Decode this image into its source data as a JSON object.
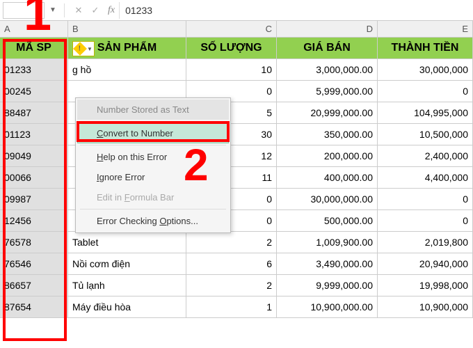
{
  "formula_bar": {
    "name_box": "",
    "fx": "fx",
    "value": "01233"
  },
  "col_headers": [
    "A",
    "B",
    "C",
    "D",
    "E"
  ],
  "table_headers": {
    "a": "MÃ SP",
    "b": "SẢN PHẨM",
    "c": "SỐ LƯỢNG",
    "d": "GIÁ BÁN",
    "e": "THÀNH TIỀN"
  },
  "rows": [
    {
      "a": "01233",
      "b": "g hồ",
      "c": "10",
      "d": "3,000,000.00",
      "e": "30,000,000"
    },
    {
      "a": "00245",
      "b": "",
      "c": "0",
      "d": "5,999,000.00",
      "e": "0"
    },
    {
      "a": "88487",
      "b": "",
      "c": "5",
      "d": "20,999,000.00",
      "e": "104,995,000"
    },
    {
      "a": "01123",
      "b": "",
      "c": "30",
      "d": "350,000.00",
      "e": "10,500,000"
    },
    {
      "a": "09049",
      "b": "",
      "c": "12",
      "d": "200,000.00",
      "e": "2,400,000"
    },
    {
      "a": "00066",
      "b": "",
      "c": "11",
      "d": "400,000.00",
      "e": "4,400,000"
    },
    {
      "a": "09987",
      "b": "",
      "c": "0",
      "d": "30,000,000.00",
      "e": "0"
    },
    {
      "a": "12456",
      "b": "",
      "c": "0",
      "d": "500,000.00",
      "e": "0"
    },
    {
      "a": "76578",
      "b": "Tablet",
      "c": "2",
      "d": "1,009,900.00",
      "e": "2,019,800"
    },
    {
      "a": "76546",
      "b": "Nồi cơm điện",
      "c": "6",
      "d": "3,490,000.00",
      "e": "20,940,000"
    },
    {
      "a": "86657",
      "b": "Tủ lạnh",
      "c": "2",
      "d": "9,999,000.00",
      "e": "19,998,000"
    },
    {
      "a": "87654",
      "b": "Máy điều hòa",
      "c": "1",
      "d": "10,900,000.00",
      "e": "10,900,000"
    }
  ],
  "error_menu": {
    "title": "Number Stored as Text",
    "convert": "Convert to Number",
    "help": "Help on this Error",
    "ignore": "Ignore Error",
    "edit": "Edit in Formula Bar",
    "options": "Error Checking Options..."
  },
  "annotations": {
    "one": "1",
    "two": "2"
  }
}
